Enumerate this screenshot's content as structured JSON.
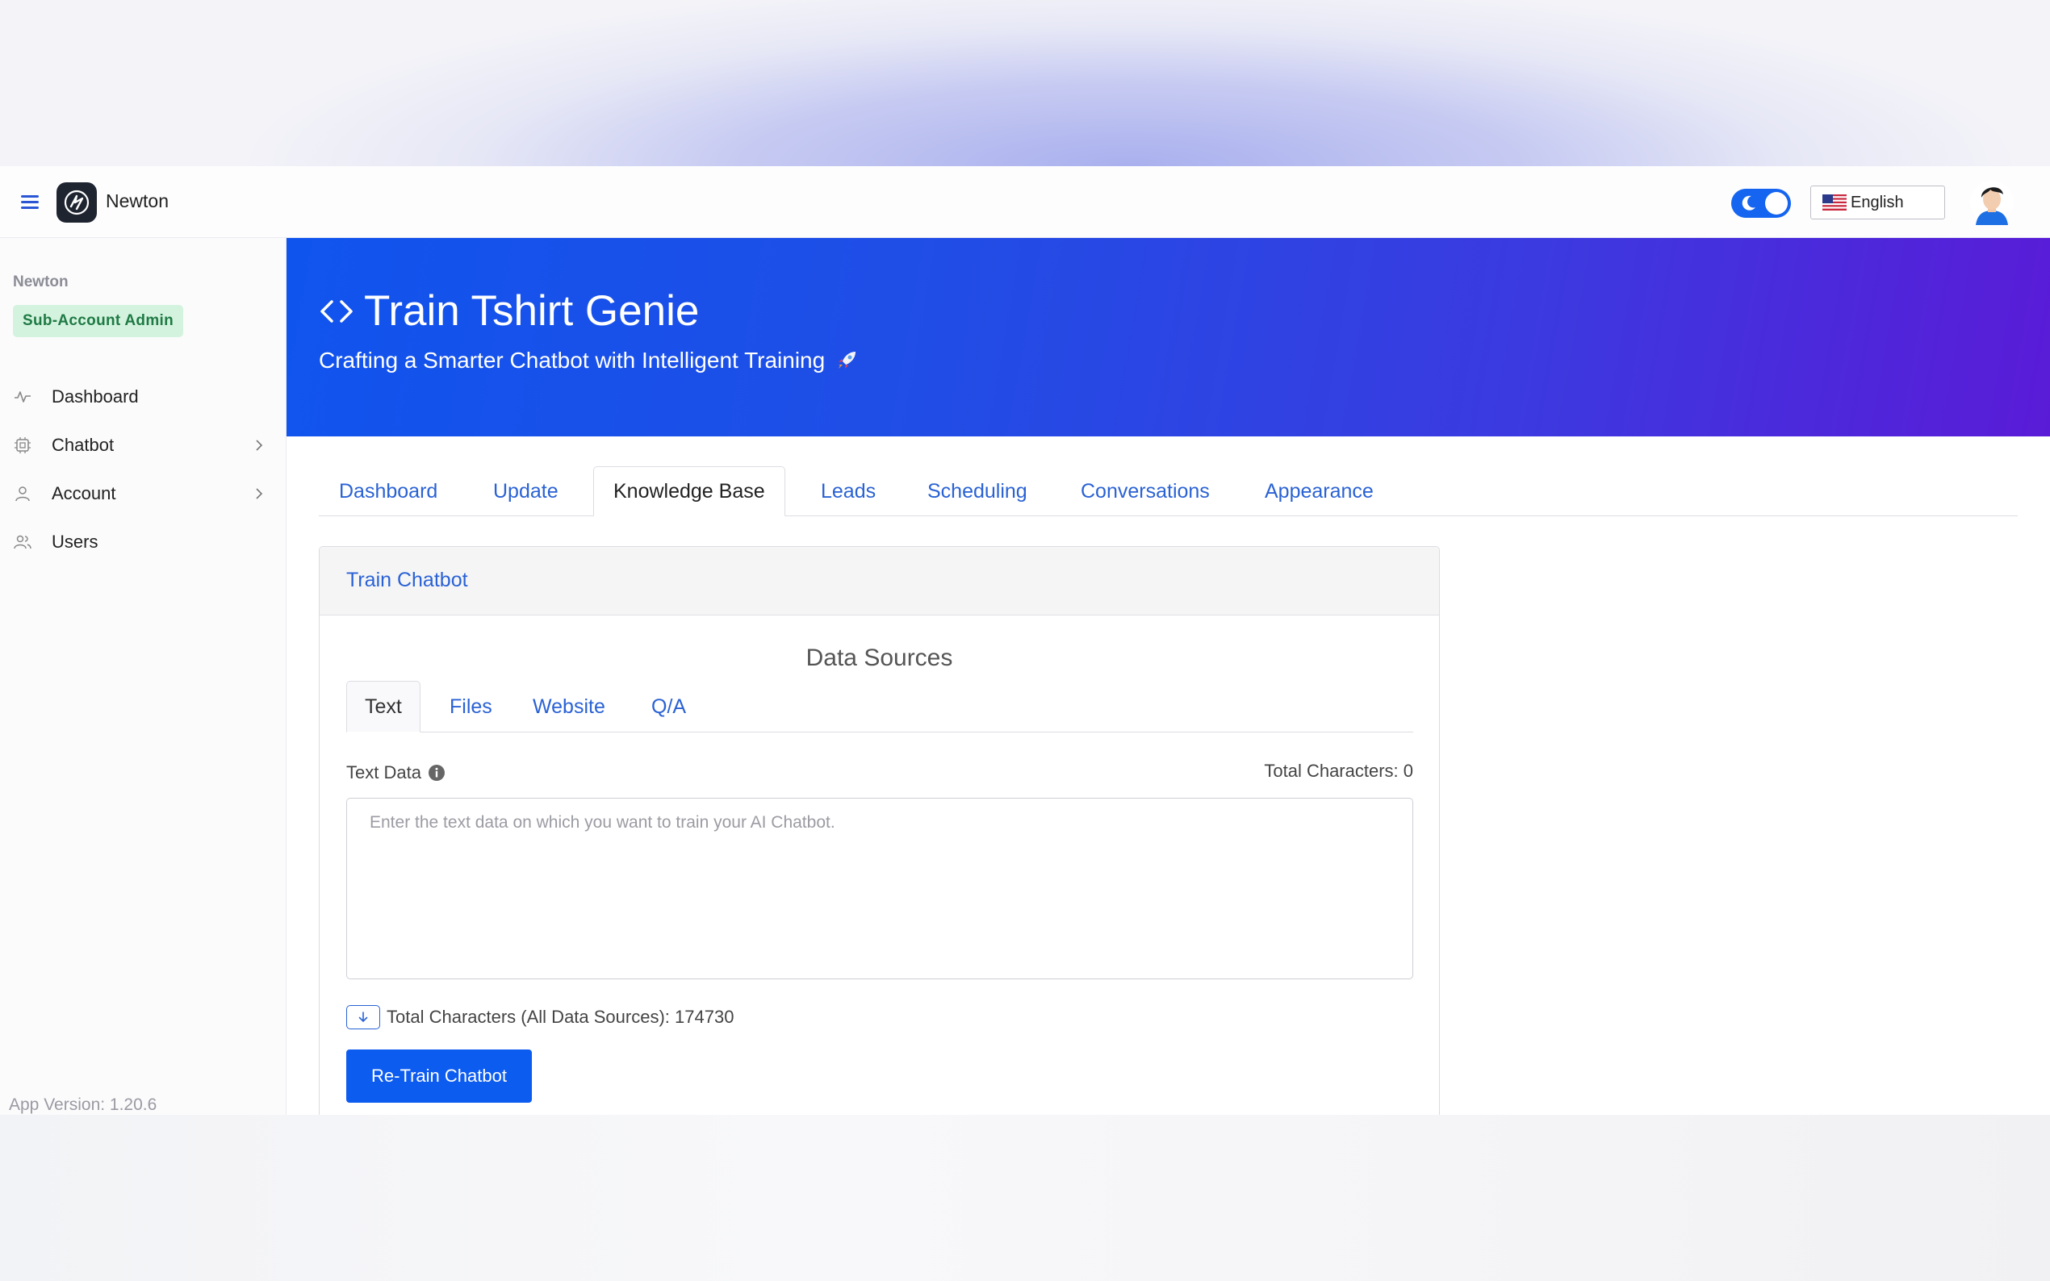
{
  "header": {
    "brand": "Newton",
    "language": "English"
  },
  "sidebar": {
    "org": "Newton",
    "role": "Sub-Account Admin",
    "items": [
      {
        "label": "Dashboard",
        "icon": "activity-icon"
      },
      {
        "label": "Chatbot",
        "icon": "chip-icon",
        "has_children": true
      },
      {
        "label": "Account",
        "icon": "user-icon",
        "has_children": true
      },
      {
        "label": "Users",
        "icon": "users-icon"
      }
    ],
    "version": "App Version: 1.20.6"
  },
  "banner": {
    "title": "Train Tshirt Genie",
    "subtitle": "Crafting a Smarter Chatbot with Intelligent Training"
  },
  "tabs": [
    {
      "label": "Dashboard"
    },
    {
      "label": "Update"
    },
    {
      "label": "Knowledge Base",
      "active": true
    },
    {
      "label": "Leads"
    },
    {
      "label": "Scheduling"
    },
    {
      "label": "Conversations"
    },
    {
      "label": "Appearance"
    }
  ],
  "card": {
    "title": "Train Chatbot",
    "data_sources_title": "Data Sources",
    "subtabs": [
      {
        "label": "Text",
        "active": true
      },
      {
        "label": "Files"
      },
      {
        "label": "Website"
      },
      {
        "label": "Q/A"
      }
    ],
    "field_label": "Text Data",
    "char_count": "Total Characters: 0",
    "placeholder": "Enter the text data on which you want to train your AI Chatbot.",
    "total_all": "Total Characters (All Data Sources): 174730",
    "retrain_label": "Re-Train Chatbot"
  },
  "colors": {
    "accent": "#0d5cf0",
    "link": "#2a62d4",
    "banner_start": "#1054ee",
    "banner_end": "#5a1bd7",
    "badge_bg": "#d4f3df",
    "badge_text": "#1f7a44"
  }
}
